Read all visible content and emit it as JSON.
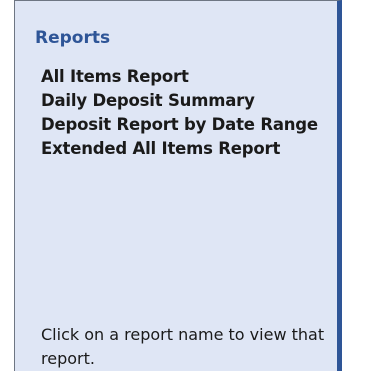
{
  "panel": {
    "title": "Reports",
    "reports": [
      {
        "label": "All Items Report"
      },
      {
        "label": "Daily Deposit Summary"
      },
      {
        "label": "Deposit Report by Date Range"
      },
      {
        "label": "Extended All Items Report"
      }
    ],
    "help_text": "Click on a report name to view that report."
  },
  "colors": {
    "panel_background": "#dfe6f5",
    "title_color": "#2e5597",
    "right_border": "#2e5597",
    "text_color": "#1a1a1a"
  }
}
